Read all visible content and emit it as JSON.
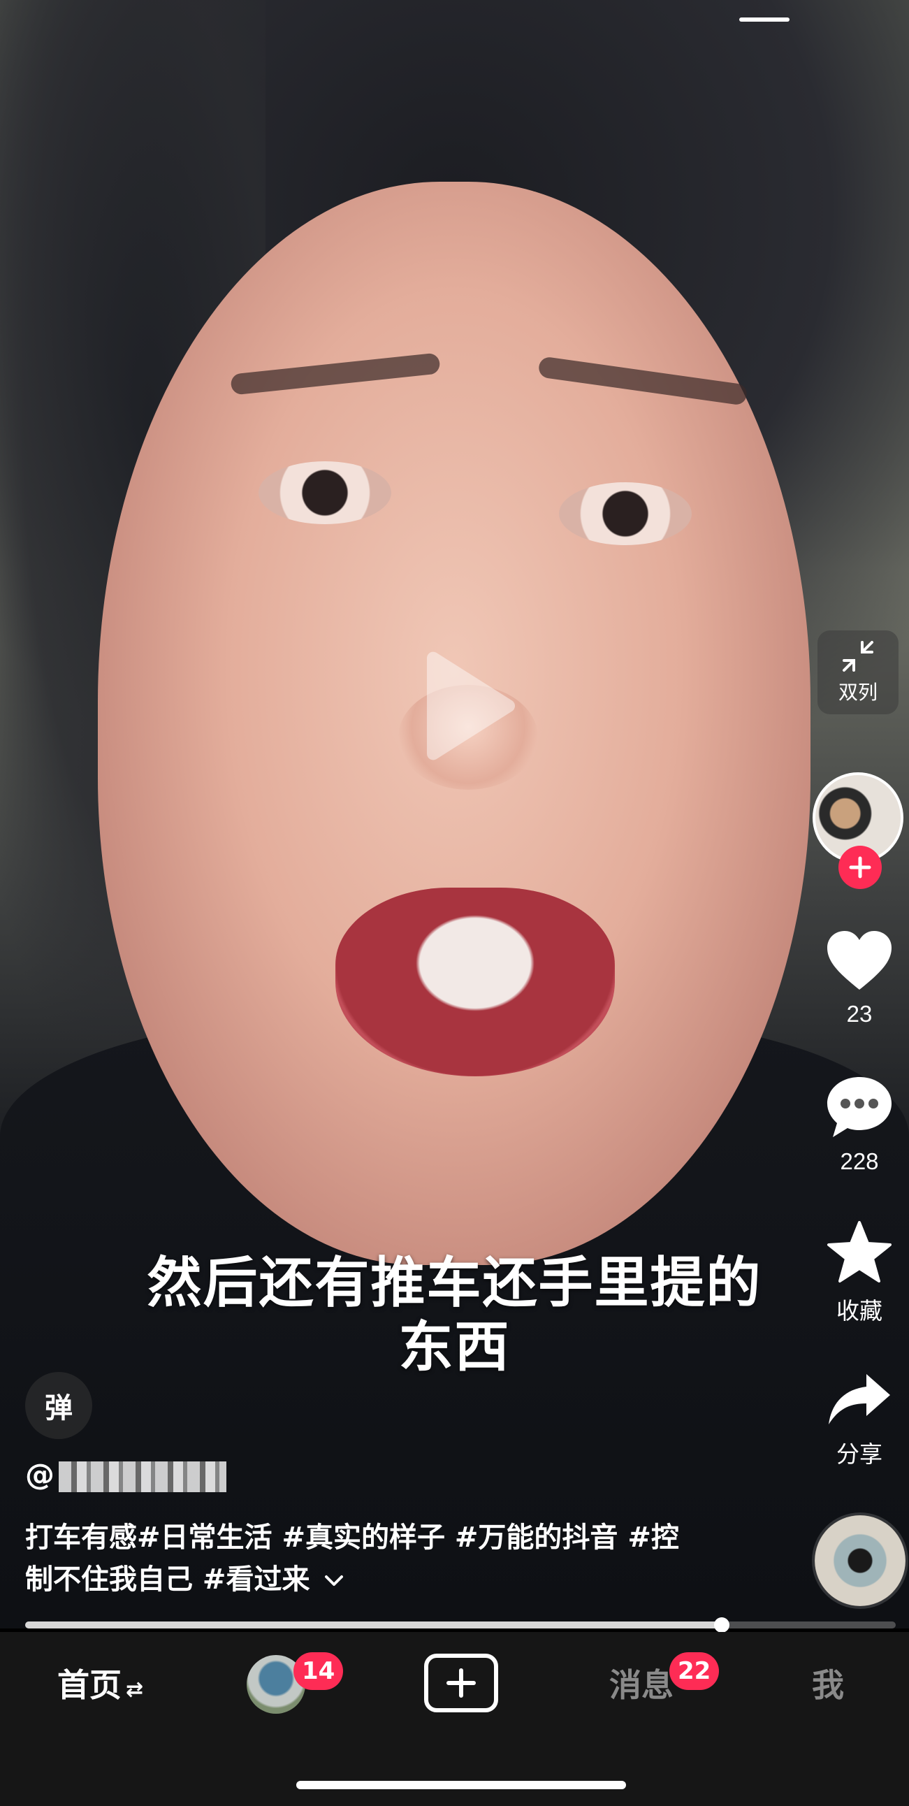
{
  "video": {
    "subtitle_line1": "然后还有推车还手里提的",
    "subtitle_line2": "东西"
  },
  "side_rail": {
    "dual_label": "双列",
    "likes_count": "23",
    "comments_count": "228",
    "favorite_label": "收藏",
    "share_label": "分享"
  },
  "danmaku_label": "弹",
  "post": {
    "username_prefix": "@",
    "caption_line1": "打车有感#日常生活 #真实的样子 #万能的抖音 #控",
    "caption_line2": "制不住我自己 #看过来"
  },
  "progress": {
    "fraction": 0.8
  },
  "bottom_nav": {
    "home_label": "首页",
    "friends_badge": "14",
    "messages_label": "消息",
    "messages_badge": "22",
    "me_label": "我"
  },
  "colors": {
    "accent": "#fe2c55",
    "nav_background": "#161616"
  }
}
